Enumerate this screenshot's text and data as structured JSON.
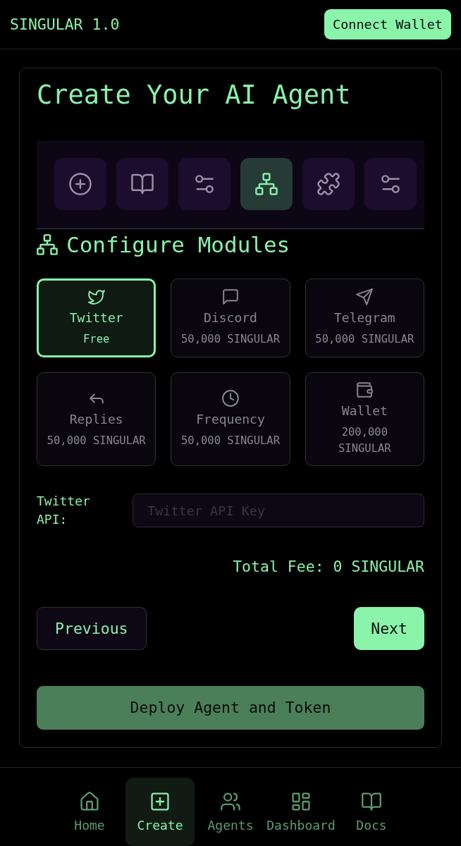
{
  "header": {
    "logo": "SINGULAR 1.0",
    "connect_button": "Connect Wallet"
  },
  "card": {
    "title": "Create Your AI Agent",
    "steps": [
      {
        "kind": "add",
        "selected": false
      },
      {
        "kind": "book",
        "selected": false
      },
      {
        "kind": "sliders",
        "selected": false
      },
      {
        "kind": "network",
        "selected": true
      },
      {
        "kind": "puzzle",
        "selected": false
      },
      {
        "kind": "sliders",
        "selected": false
      }
    ],
    "section_title": "Configure Modules",
    "modules": [
      {
        "kind": "bird",
        "name": "Twitter",
        "price": "Free",
        "selected": true
      },
      {
        "kind": "chat",
        "name": "Discord",
        "price": "50,000 SINGULAR",
        "selected": false
      },
      {
        "kind": "plane",
        "name": "Telegram",
        "price": "50,000 SINGULAR",
        "selected": false
      },
      {
        "kind": "reply",
        "name": "Replies",
        "price": "50,000 SINGULAR",
        "selected": false
      },
      {
        "kind": "clock",
        "name": "Frequency",
        "price": "50,000 SINGULAR",
        "selected": false
      },
      {
        "kind": "wallet",
        "name": "Wallet",
        "price": "200,000 SINGULAR",
        "selected": false
      }
    ],
    "api_field": {
      "label": "Twitter API:",
      "placeholder": "Twitter API Key"
    },
    "total_fee": "Total Fee: 0 SINGULAR",
    "previous_button": "Previous",
    "next_button": "Next",
    "deploy_button": "Deploy Agent and Token"
  },
  "bottom_nav": [
    {
      "kind": "home",
      "label": "Home",
      "selected": false
    },
    {
      "kind": "plus-square",
      "label": "Create",
      "selected": true
    },
    {
      "kind": "users",
      "label": "Agents",
      "selected": false
    },
    {
      "kind": "grid",
      "label": "Dashboard",
      "selected": false
    },
    {
      "kind": "book",
      "label": "Docs",
      "selected": false
    }
  ]
}
